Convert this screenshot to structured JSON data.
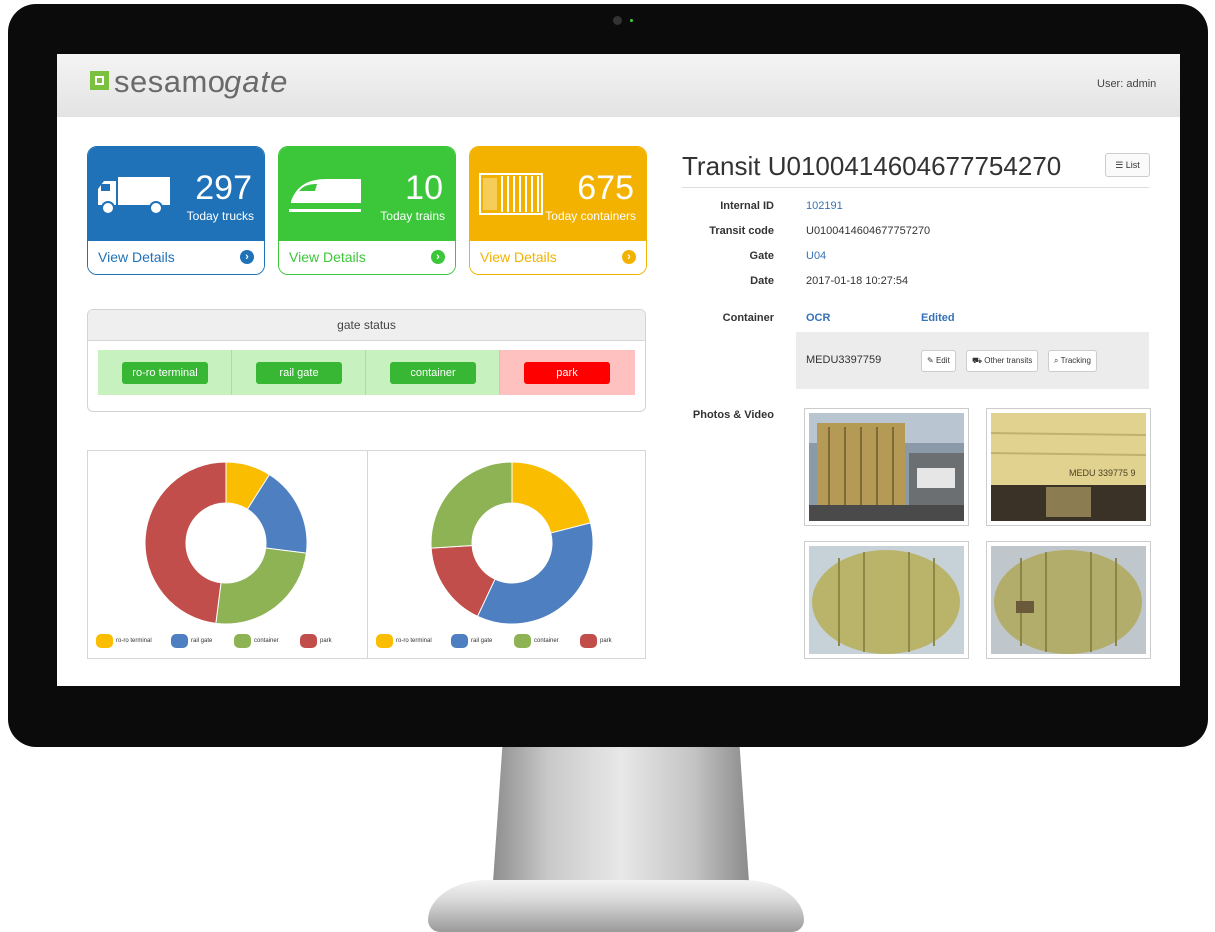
{
  "app": {
    "logo_part1": "sesamo",
    "logo_part2": "gate",
    "user_label": "User: admin"
  },
  "colors": {
    "blue": "#1f72b8",
    "green": "#3cc63a",
    "yellow": "#f3b200",
    "red": "#ff0000",
    "link": "#3572b7",
    "logo_green": "#7cc03f"
  },
  "stats": [
    {
      "value": "297",
      "label": "Today trucks",
      "link": "View Details",
      "icon": "truck-icon"
    },
    {
      "value": "10",
      "label": "Today trains",
      "link": "View Details",
      "icon": "train-icon"
    },
    {
      "value": "675",
      "label": "Today containers",
      "link": "View Details",
      "icon": "container-icon"
    }
  ],
  "gate_status": {
    "title": "gate status",
    "items": [
      {
        "label": "ro-ro terminal",
        "state": "ok"
      },
      {
        "label": "rail gate",
        "state": "ok"
      },
      {
        "label": "container",
        "state": "ok"
      },
      {
        "label": "park",
        "state": "alert"
      }
    ]
  },
  "legend": [
    "ro-ro terminal",
    "rail gate",
    "container",
    "park"
  ],
  "chart_data": [
    {
      "type": "pie",
      "categories": [
        "ro-ro terminal",
        "rail gate",
        "container",
        "park"
      ],
      "values": [
        9,
        18,
        25,
        48
      ],
      "colors": [
        "#fbbd00",
        "#4d7fc1",
        "#8db354",
        "#c14e4a"
      ],
      "legend_position": "bottom"
    },
    {
      "type": "pie",
      "categories": [
        "ro-ro terminal",
        "rail gate",
        "container",
        "park"
      ],
      "values": [
        21,
        36,
        17,
        26
      ],
      "colors": [
        "#fbbd00",
        "#4d7fc1",
        "#c14e4a",
        "#8db354"
      ],
      "legend_position": "bottom"
    }
  ],
  "transit": {
    "title": "Transit U0100414604677754270",
    "list_button": "List",
    "fields": [
      {
        "label": "Internal ID",
        "value": "102191",
        "link": true
      },
      {
        "label": "Transit code",
        "value": "U0100414604677757270",
        "link": false
      },
      {
        "label": "Gate",
        "value": "U04",
        "link": true
      },
      {
        "label": "Date",
        "value": "2017-01-18 10:27:54",
        "link": false
      }
    ],
    "container_label": "Container",
    "col_ocr": "OCR",
    "col_edited": "Edited",
    "container_code": "MEDU3397759",
    "buttons": {
      "edit": "Edit",
      "other": "Other transits",
      "tracking": "Tracking"
    },
    "photos_label": "Photos & Video",
    "photos": [
      {
        "desc": "container-truck-front",
        "overlay_text": ""
      },
      {
        "desc": "container-back",
        "overlay_text": "MEDU 339775 9"
      },
      {
        "desc": "container-side-1",
        "overlay_text": ""
      },
      {
        "desc": "container-side-2",
        "overlay_text": ""
      }
    ]
  }
}
